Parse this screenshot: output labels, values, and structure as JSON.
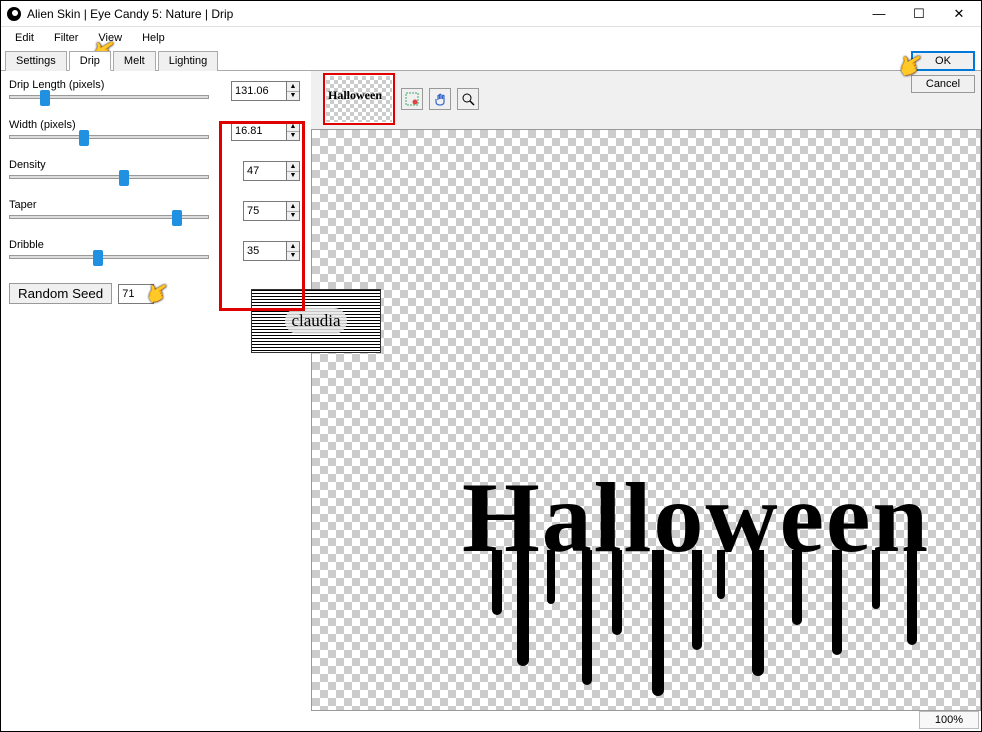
{
  "title": "Alien Skin | Eye Candy 5: Nature | Drip",
  "menu": {
    "edit": "Edit",
    "filter": "Filter",
    "view": "View",
    "help": "Help"
  },
  "tabs": {
    "settings": "Settings",
    "drip": "Drip",
    "melt": "Melt",
    "lighting": "Lighting"
  },
  "controls": {
    "drip_length": {
      "label": "Drip Length (pixels)",
      "value": "131.06",
      "pos": 15
    },
    "width": {
      "label": "Width (pixels)",
      "value": "16.81",
      "pos": 35
    },
    "density": {
      "label": "Density",
      "value": "47",
      "pos": 55
    },
    "taper": {
      "label": "Taper",
      "value": "75",
      "pos": 82
    },
    "dribble": {
      "label": "Dribble",
      "value": "35",
      "pos": 42
    }
  },
  "random_seed": {
    "button": "Random Seed",
    "value": "71"
  },
  "buttons": {
    "ok": "OK",
    "cancel": "Cancel"
  },
  "preview_text": "Halloween",
  "watermark": "claudia",
  "zoom": "100%"
}
